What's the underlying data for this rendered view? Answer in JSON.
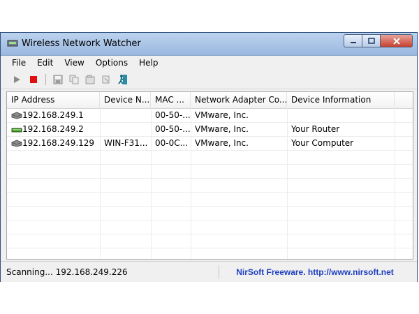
{
  "window": {
    "title": "Wireless Network Watcher"
  },
  "menu": [
    "File",
    "Edit",
    "View",
    "Options",
    "Help"
  ],
  "toolbar": {
    "icons": [
      "play-icon",
      "stop-icon",
      "save-icon",
      "copy-icon",
      "properties-icon",
      "refresh-icon",
      "exit-icon"
    ]
  },
  "table": {
    "columns": [
      "IP Address",
      "Device N...",
      "MAC ...",
      "Network Adapter Co...",
      "Device Information"
    ],
    "rows": [
      {
        "ip": "192.168.249.1",
        "device": "",
        "mac": "00-50-...",
        "adapter": "VMware, Inc.",
        "info": "",
        "icon": "network-device-icon"
      },
      {
        "ip": "192.168.249.2",
        "device": "",
        "mac": "00-50-...",
        "adapter": "VMware, Inc.",
        "info": "Your Router",
        "icon": "router-icon"
      },
      {
        "ip": "192.168.249.129",
        "device": "WIN-F31...",
        "mac": "00-0C...",
        "adapter": "VMware, Inc.",
        "info": "Your Computer",
        "icon": "computer-icon"
      }
    ]
  },
  "status": {
    "left": "Scanning... 192.168.249.226",
    "right": "NirSoft Freeware.  http://www.nirsoft.net"
  },
  "colors": {
    "link": "#1f3fc0",
    "stop": "#e01010",
    "play": "#7a7a7a"
  }
}
